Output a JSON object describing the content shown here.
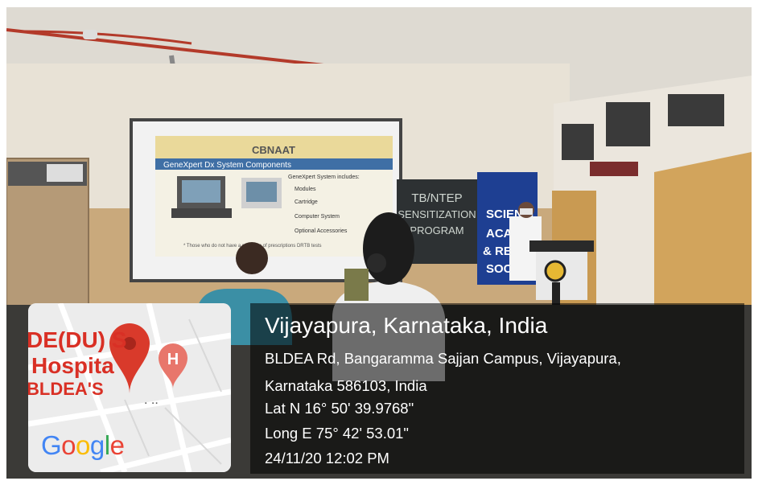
{
  "slide": {
    "title": "CBNAAT",
    "subtitle": "GeneXpert Dx System Components",
    "lines": [
      "GeneXpert System includes:",
      "Modules",
      "Cartridge",
      "Computer System",
      "Optional Accessories"
    ],
    "footnote": "* Those who do not have a provision of prescriptions DRTB tests"
  },
  "banner_text": [
    "TB/NTEP",
    "SENSITIZATION",
    "PROGRAM"
  ],
  "blue_board": [
    "SCIENTI",
    "ACA",
    "& RES",
    "SOC"
  ],
  "map": {
    "labels": [
      "DE(DU) S",
      "Hospita",
      "BLDEA'S"
    ],
    "hospital_marker": "H",
    "google_letters": [
      {
        "ch": "G",
        "color": "#4285F4"
      },
      {
        "ch": "o",
        "color": "#EA4335"
      },
      {
        "ch": "o",
        "color": "#FBBC05"
      },
      {
        "ch": "g",
        "color": "#4285F4"
      },
      {
        "ch": "l",
        "color": "#34A853"
      },
      {
        "ch": "e",
        "color": "#EA4335"
      }
    ]
  },
  "location": {
    "title": "Vijayapura, Karnataka, India",
    "address_line1": "BLDEA Rd, Bangaramma Sajjan Campus, Vijayapura,",
    "address_line2": "Karnataka 586103, India",
    "latitude": "Lat N 16° 50' 39.9768\"",
    "longitude": "Long E 75° 42' 53.01\"",
    "timestamp": "24/11/20 12:02 PM"
  }
}
